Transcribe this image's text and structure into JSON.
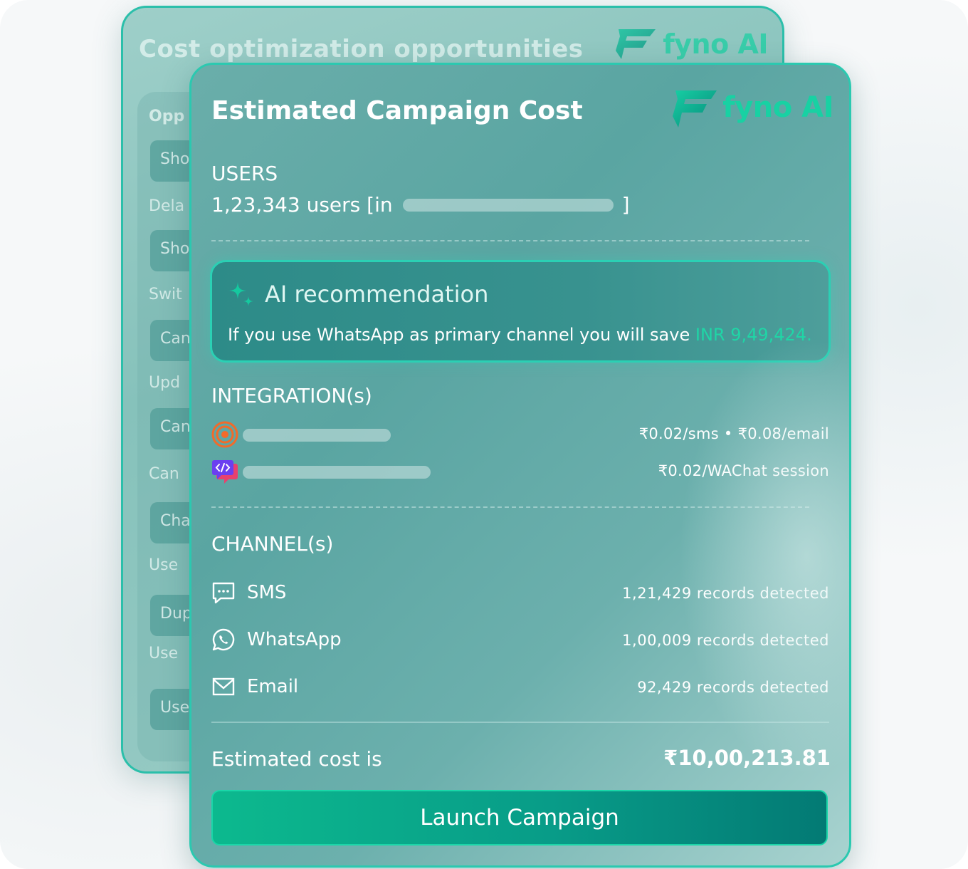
{
  "back_card": {
    "title": "Cost optimization opportunities",
    "logo_text": "fyno AI",
    "rows": [
      {
        "text": "Opp",
        "kind": "header"
      },
      {
        "text": "Sho",
        "kind": "pill"
      },
      {
        "text": "Dela",
        "kind": "text"
      },
      {
        "text": "Sho",
        "kind": "pill"
      },
      {
        "text": "Swit",
        "kind": "text"
      },
      {
        "text": "Can",
        "kind": "pill"
      },
      {
        "text": "Upd",
        "kind": "text"
      },
      {
        "text": "Can",
        "kind": "pill"
      },
      {
        "text": "Can",
        "kind": "text"
      },
      {
        "text": "Cha",
        "kind": "pill"
      },
      {
        "text": "Use",
        "kind": "text"
      },
      {
        "text": "Dup",
        "kind": "pill"
      },
      {
        "text": "Use",
        "kind": "text"
      },
      {
        "text": "Use",
        "kind": "pill"
      }
    ]
  },
  "card": {
    "title": "Estimated Campaign Cost",
    "logo_text": "fyno AI"
  },
  "users": {
    "label": "USERS",
    "count_text": "1,23,343 users [in",
    "close_bracket": "]"
  },
  "recommendation": {
    "title": "AI recommendation",
    "text_main": "If you use WhatsApp as primary channel you will save ",
    "text_highlight": "INR 9,49,424."
  },
  "integrations": {
    "label": "INTEGRATION(s)",
    "items": [
      {
        "icon": "target-icon",
        "price": "₹0.02/sms • ₹0.08/email"
      },
      {
        "icon": "code-chat-icon",
        "price": "₹0.02/WAChat session"
      }
    ]
  },
  "channels": {
    "label": "CHANNEL(s)",
    "items": [
      {
        "icon": "sms-icon",
        "name": "SMS",
        "count": "1,21,429 records detected"
      },
      {
        "icon": "whatsapp-icon",
        "name": "WhatsApp",
        "count": "1,00,009 records detected"
      },
      {
        "icon": "email-icon",
        "name": "Email",
        "count": "92,429 records detected"
      }
    ]
  },
  "estimate": {
    "label": "Estimated cost is",
    "value": "₹10,00,213.81"
  },
  "launch_button": "Launch Campaign",
  "colors": {
    "accent": "#18d1a3",
    "card_border": "#2bc9b0",
    "button_start": "#0cb98e",
    "button_end": "#037a74"
  }
}
